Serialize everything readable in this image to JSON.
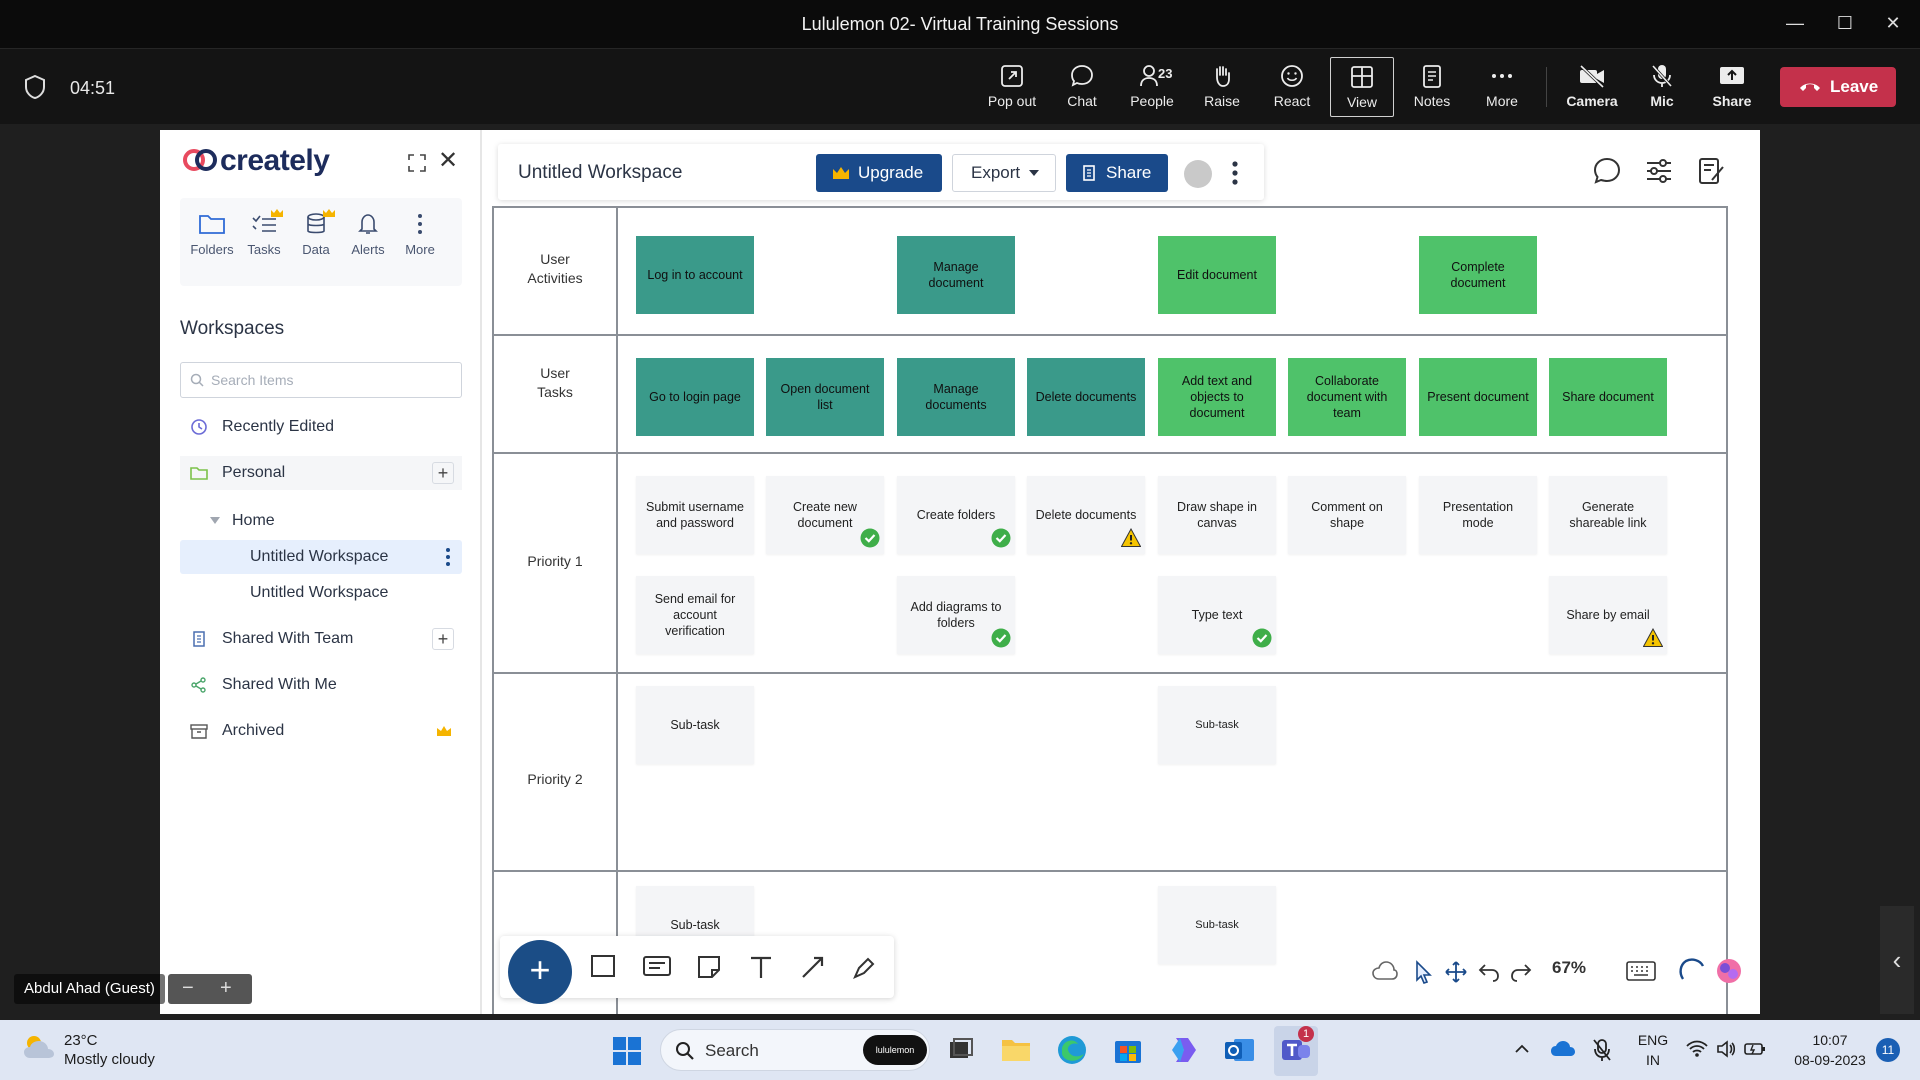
{
  "window": {
    "title": "Lululemon 02- Virtual Training Sessions"
  },
  "meeting": {
    "timer": "04:51",
    "people_count": "23",
    "buttons": {
      "popout": "Pop out",
      "chat": "Chat",
      "people": "People",
      "raise": "Raise",
      "react": "React",
      "view": "View",
      "notes": "Notes",
      "more": "More",
      "camera": "Camera",
      "mic": "Mic",
      "share": "Share"
    },
    "leave": "Leave",
    "participant": "Abdul Ahad (Guest)"
  },
  "creately": {
    "logo": "creately",
    "nav": {
      "folders": "Folders",
      "tasks": "Tasks",
      "data": "Data",
      "alerts": "Alerts",
      "more": "More"
    },
    "workspaces_title": "Workspaces",
    "search_placeholder": "Search Items",
    "tree": {
      "recently_edited": "Recently Edited",
      "personal": "Personal",
      "home": "Home",
      "ws1": "Untitled Workspace",
      "ws2": "Untitled Workspace",
      "shared_team": "Shared With Team",
      "shared_me": "Shared With Me",
      "archived": "Archived"
    },
    "header": {
      "workspace_name": "Untitled Workspace",
      "upgrade": "Upgrade",
      "export": "Export",
      "share": "Share"
    },
    "zoom": "67%",
    "accent": "#1a4a8a"
  },
  "board": {
    "lanes": {
      "activities": "User\nActivities",
      "tasks": "User\nTasks",
      "p1": "Priority 1",
      "p2": "Priority 2"
    },
    "activities": [
      "Log in to account",
      "Manage document",
      "Edit document",
      "Complete document"
    ],
    "tasks": [
      "Go to login page",
      "Open document list",
      "Manage documents",
      "Delete documents",
      "Add text and objects to document",
      "Collaborate document with team",
      "Present document",
      "Share document"
    ],
    "p1_row1": [
      "Submit username and password",
      "Create new document",
      "Create folders",
      "Delete documents",
      "Draw shape in canvas",
      "Comment on shape",
      "Presentation mode",
      "Generate shareable link"
    ],
    "p1_row2": [
      "Send email for account verification",
      "Add diagrams to folders",
      "Type text",
      "Share by email"
    ],
    "subtask": "Sub-task"
  },
  "taskbar": {
    "temp": "23°C",
    "weather": "Mostly cloudy",
    "search": "Search",
    "pill": "lululemon",
    "lang1": "ENG",
    "lang2": "IN",
    "time": "10:07",
    "date": "08-09-2023",
    "notif": "11"
  }
}
